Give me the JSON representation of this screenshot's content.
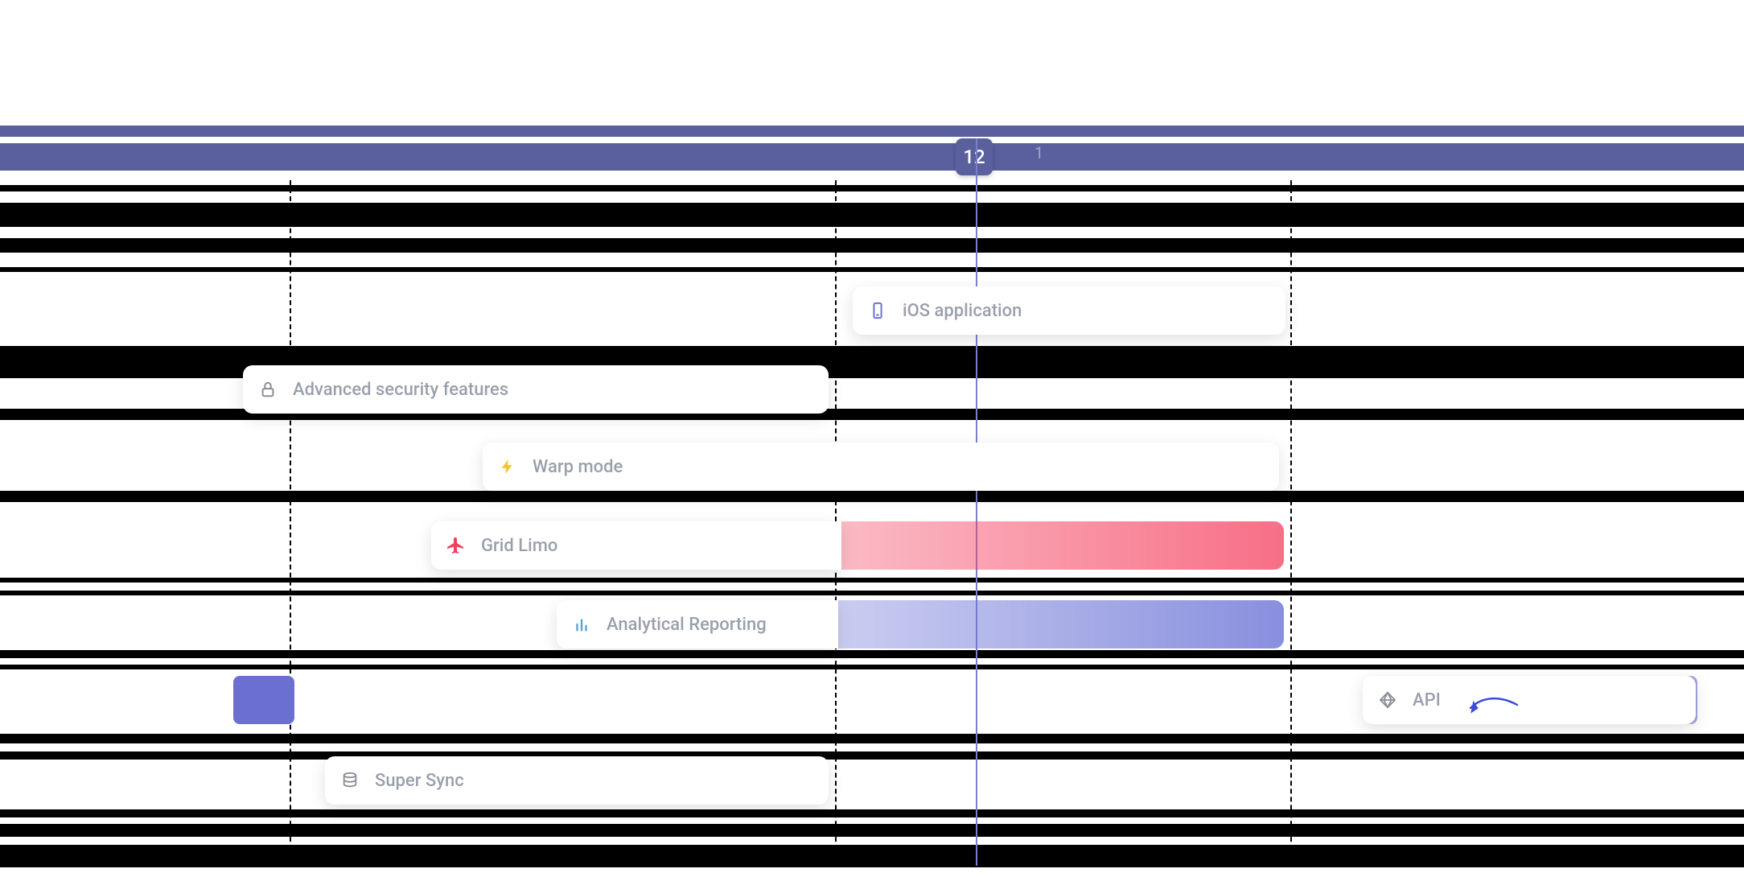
{
  "timeline": {
    "date_current": "12",
    "date_next": "1"
  },
  "tasks": {
    "ios": {
      "label": "iOS application",
      "icon": "phone-icon",
      "tint": "#6b73d6"
    },
    "security": {
      "label": "Advanced security features",
      "icon": "lock-icon",
      "tint": "#8b8f96"
    },
    "warp": {
      "label": "Warp mode",
      "icon": "bolt-icon",
      "tint": "#f4c430"
    },
    "gridlimo": {
      "label": "Grid Limo",
      "icon": "plane-icon",
      "tint": "#f43f5e"
    },
    "analytical": {
      "label": "Analytical Reporting",
      "icon": "bars-icon",
      "tint": "#4ea8de"
    },
    "api": {
      "label": "API",
      "icon": "diamond-icon",
      "tint": "#8b8f96"
    },
    "supersync": {
      "label": "Super Sync",
      "icon": "database-icon",
      "tint": "#8b8f96"
    }
  }
}
